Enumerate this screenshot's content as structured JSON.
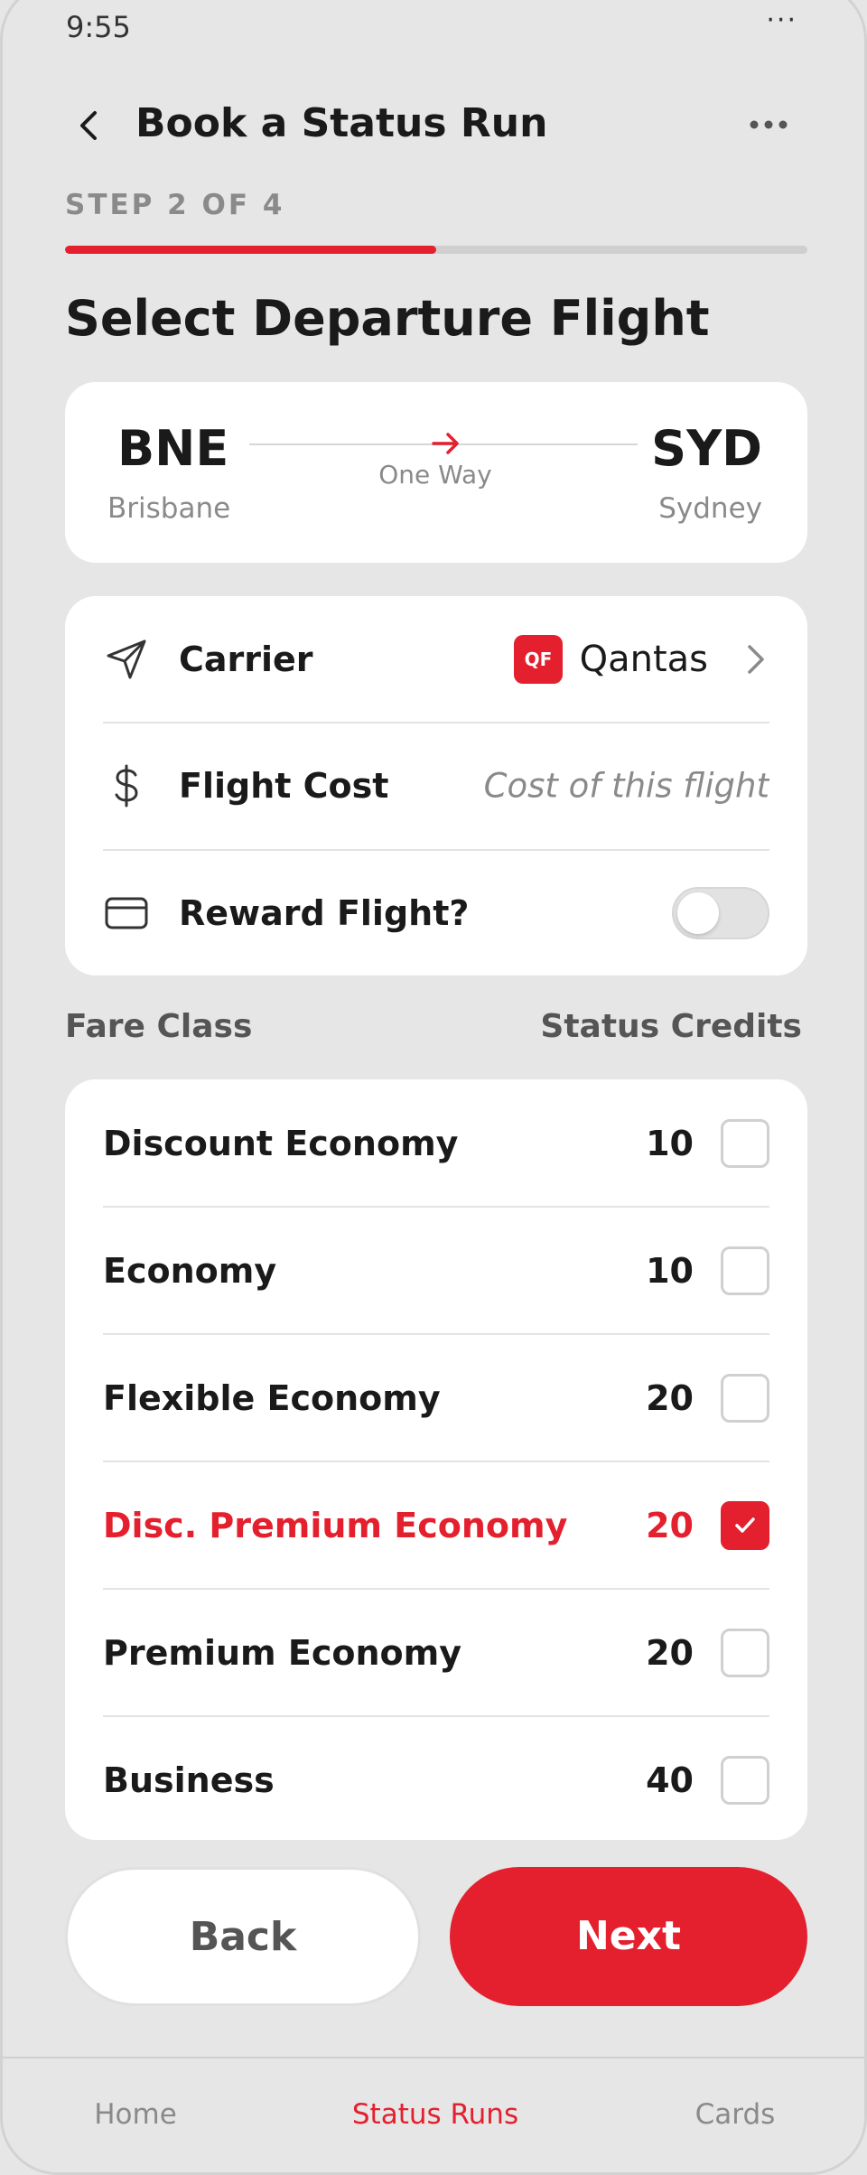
{
  "status_bar": {
    "time": "9:55",
    "overflow": "···"
  },
  "header": {
    "title": "Book a Status Run",
    "back_icon": "chevron-left-icon",
    "more_icon": "more-horizontal-icon"
  },
  "step": {
    "label": "STEP 2 OF 4",
    "current": 2,
    "total": 4,
    "progress_fraction": 0.5
  },
  "section_title": "Select Departure Flight",
  "route": {
    "origin_code": "BNE",
    "origin_city": "Brisbane",
    "destination_code": "SYD",
    "destination_city": "Sydney",
    "trip_type": "One Way",
    "arrow_icon": "arrow-right-icon"
  },
  "details": {
    "carrier": {
      "label": "Carrier",
      "badge": "QF",
      "value": "Qantas",
      "icon": "send-icon"
    },
    "cost": {
      "label": "Flight Cost",
      "placeholder": "Cost of this flight",
      "value": "",
      "icon": "dollar-icon"
    },
    "reward": {
      "label": "Reward Flight?",
      "enabled": false,
      "icon": "credit-card-icon"
    }
  },
  "fare_header": {
    "left": "Fare Class",
    "right": "Status Credits"
  },
  "fares": [
    {
      "name": "Discount Economy",
      "credits": "10",
      "selected": false
    },
    {
      "name": "Economy",
      "credits": "10",
      "selected": false
    },
    {
      "name": "Flexible Economy",
      "credits": "20",
      "selected": false
    },
    {
      "name": "Disc. Premium Economy",
      "credits": "20",
      "selected": true
    },
    {
      "name": "Premium Economy",
      "credits": "20",
      "selected": false
    },
    {
      "name": "Business",
      "credits": "40",
      "selected": false
    }
  ],
  "buttons": {
    "back": "Back",
    "next": "Next"
  },
  "nav": [
    {
      "label": "Home",
      "active": false
    },
    {
      "label": "Status Runs",
      "active": true
    },
    {
      "label": "Cards",
      "active": false
    }
  ],
  "colors": {
    "accent": "#e4202e",
    "background": "#e6e6e6",
    "card": "#ffffff",
    "muted": "#8a8a8a"
  }
}
